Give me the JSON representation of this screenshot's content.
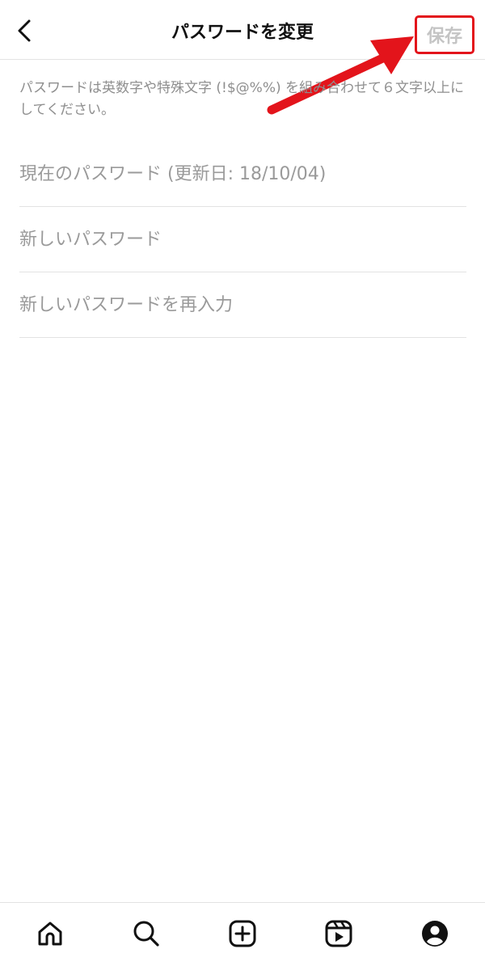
{
  "header": {
    "title": "パスワードを変更",
    "back_icon": "chevron-left-icon",
    "save_label": "保存"
  },
  "hint": "パスワードは英数字や特殊文字 (!$@%%) を組み合わせて６文字以上にしてください。",
  "fields": {
    "current_placeholder": "現在のパスワード (更新日: 18/10/04)",
    "new_placeholder": "新しいパスワード",
    "confirm_placeholder": "新しいパスワードを再入力"
  },
  "tabbar": {
    "items": [
      "home-icon",
      "search-icon",
      "add-post-icon",
      "reels-icon",
      "profile-icon"
    ]
  },
  "colors": {
    "highlight_red": "#e3141b",
    "save_disabled": "#c4c4c4",
    "hint_text": "#8e8e8e"
  }
}
